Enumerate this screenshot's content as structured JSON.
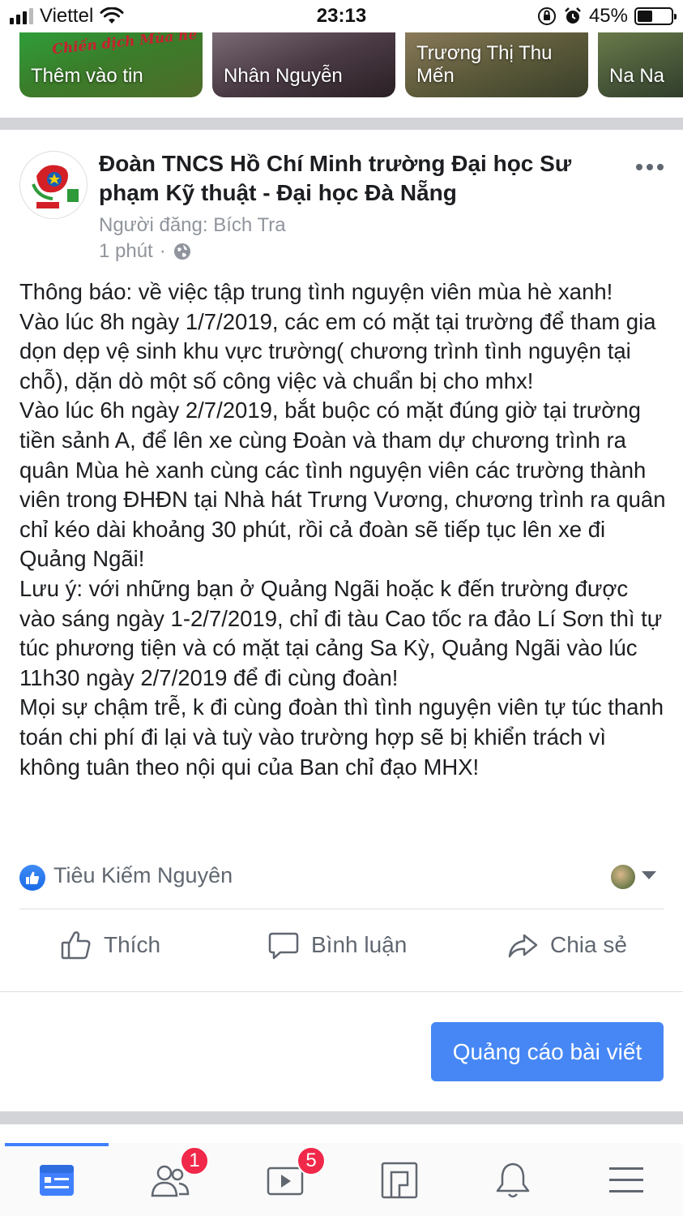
{
  "status_bar": {
    "carrier": "Viettel",
    "time": "23:13",
    "battery": "45%",
    "battery_level": 0.45
  },
  "stories": [
    {
      "label": "Thêm vào tin",
      "banner": "Chiến dịch Mùa hè"
    },
    {
      "label": "Nhân Nguyễn"
    },
    {
      "label": "Trương Thị Thu Mến"
    },
    {
      "label": "Na Na"
    }
  ],
  "post": {
    "page_name": "Đoàn TNCS Hồ Chí Minh trường Đại học Sư phạm Kỹ thuật - Đại học Đà Nẵng",
    "posted_by": "Người đăng: Bích Tra",
    "time": "1 phút",
    "separator": "·",
    "paragraphs": [
      "Thông báo: về việc tập trung tình nguyện viên mùa hè xanh!",
      "Vào lúc 8h ngày 1/7/2019, các em có mặt tại trường để tham gia dọn dẹp vệ sinh khu vực trường( chương trình tình nguyện tại chỗ), dặn dò một số công việc và chuẩn bị cho mhx!",
      "Vào lúc 6h ngày 2/7/2019, bắt buộc có mặt đúng giờ tại trường tiền sảnh A, để lên xe cùng Đoàn và tham dự chương trình ra quân Mùa hè xanh cùng các tình nguyện viên các trường thành viên trong ĐHĐN tại Nhà hát Trưng Vương, chương trình ra quân chỉ kéo dài khoảng 30 phút, rồi cả đoàn sẽ tiếp tục lên xe đi Quảng Ngãi!",
      "Lưu ý: với những bạn ở Quảng Ngãi hoặc k đến trường được vào sáng ngày 1-2/7/2019, chỉ đi tàu Cao tốc ra đảo Lí Sơn thì tự túc phương tiện và có mặt tại cảng Sa Kỳ, Quảng Ngãi vào lúc",
      "11h30 ngày 2/7/2019 để đi cùng đoàn!",
      "Mọi sự chậm trễ, k đi cùng đoàn thì tình nguyện viên tự túc thanh toán chi phí đi lại và tuỳ vào trường hợp sẽ bị khiển trách vì không tuân theo nội qui của Ban chỉ đạo MHX!"
    ],
    "reactor": "Tiêu Kiếm Nguyên"
  },
  "actions": {
    "like": "Thích",
    "comment": "Bình luận",
    "share": "Chia sẻ"
  },
  "boost_button": "Quảng cáo bài viết",
  "tabbar": {
    "friends_badge": "1",
    "watch_badge": "5"
  },
  "colors": {
    "accent": "#4687f5",
    "badge": "#f02849",
    "secondary_text": "#606770"
  }
}
